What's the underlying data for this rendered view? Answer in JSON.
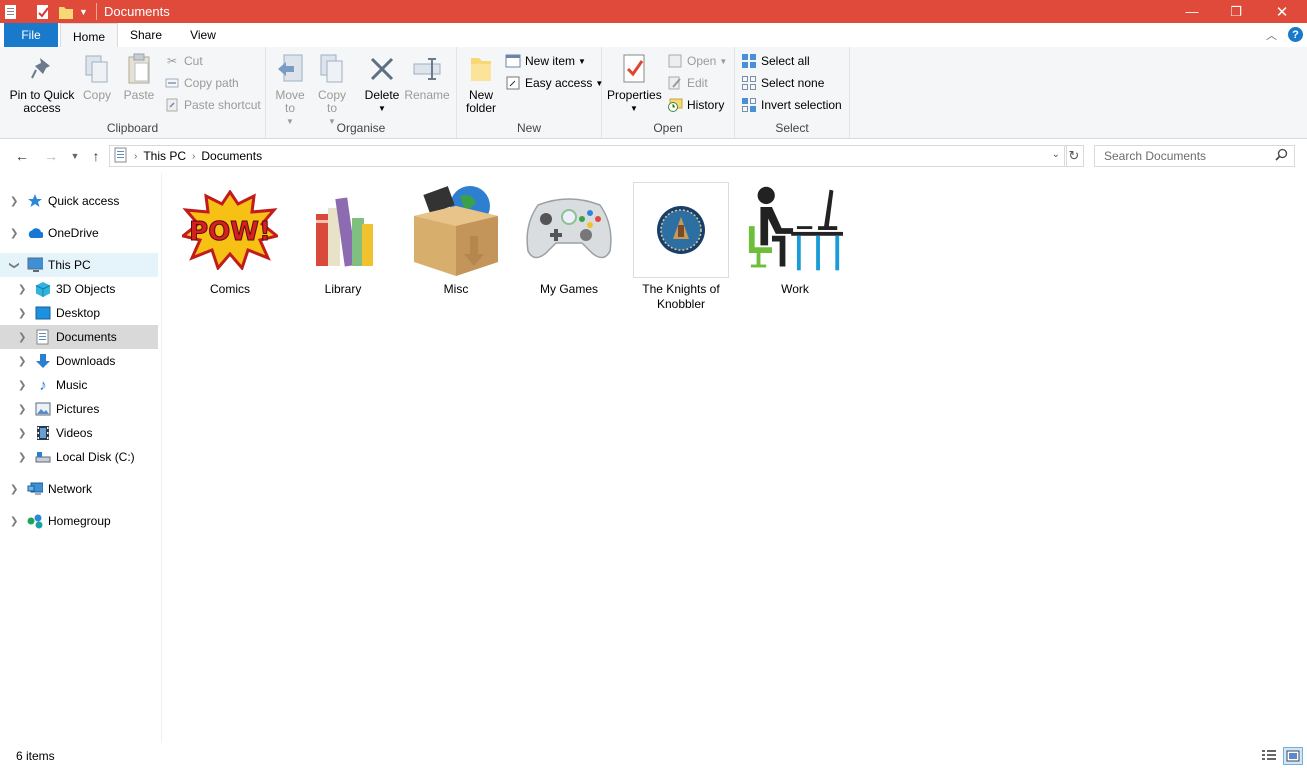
{
  "window": {
    "title": "Documents",
    "minimize_glyph": "—",
    "maximize_glyph": "❐",
    "close_glyph": "✕"
  },
  "colors": {
    "titlebar": "#e04a3a",
    "file_tab": "#1979ca",
    "selected_nav": "#d9d9d9",
    "hover_nav": "#e5f3fb"
  },
  "tabs": {
    "file": "File",
    "home": "Home",
    "share": "Share",
    "view": "View"
  },
  "ribbon": {
    "clipboard": {
      "label": "Clipboard",
      "pin": "Pin to Quick access",
      "copy": "Copy",
      "paste": "Paste",
      "cut": "Cut",
      "copy_path": "Copy path",
      "paste_shortcut": "Paste shortcut"
    },
    "organise": {
      "label": "Organise",
      "move_to": "Move to",
      "copy_to": "Copy to",
      "delete": "Delete",
      "rename": "Rename"
    },
    "new": {
      "label": "New",
      "new_folder": "New folder",
      "new_item": "New item",
      "easy_access": "Easy access"
    },
    "open": {
      "label": "Open",
      "properties": "Properties",
      "open": "Open",
      "edit": "Edit",
      "history": "History"
    },
    "select": {
      "label": "Select",
      "select_all": "Select all",
      "select_none": "Select none",
      "invert_selection": "Invert selection"
    }
  },
  "address": {
    "crumbs": [
      "This PC",
      "Documents"
    ],
    "search_placeholder": "Search Documents"
  },
  "nav": {
    "quick_access": "Quick access",
    "onedrive": "OneDrive",
    "this_pc": "This PC",
    "objects3d": "3D Objects",
    "desktop": "Desktop",
    "documents": "Documents",
    "downloads": "Downloads",
    "music": "Music",
    "pictures": "Pictures",
    "videos": "Videos",
    "local_disk": "Local Disk (C:)",
    "network": "Network",
    "homegroup": "Homegroup"
  },
  "items": [
    {
      "name": "Comics",
      "icon": "pow-icon"
    },
    {
      "name": "Library",
      "icon": "books-icon"
    },
    {
      "name": "Misc",
      "icon": "box-icon"
    },
    {
      "name": "My Games",
      "icon": "gamepad-icon"
    },
    {
      "name": "The Knights of Knobbler",
      "icon": "emblem-icon"
    },
    {
      "name": "Work",
      "icon": "desk-worker-icon"
    }
  ],
  "status": {
    "count": "6 items"
  }
}
